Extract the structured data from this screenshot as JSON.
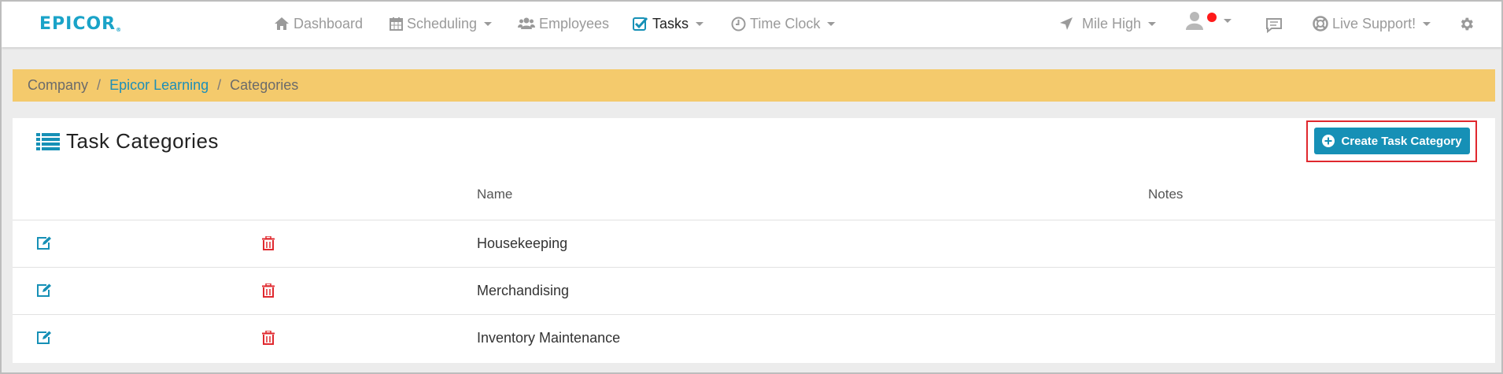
{
  "brand": {
    "logo_text": "EPICOR",
    "logo_mark": "®",
    "color": "#1aa3c8"
  },
  "nav": {
    "items": [
      {
        "label": "Dashboard",
        "icon": "home-icon"
      },
      {
        "label": "Scheduling",
        "icon": "calendar-icon"
      },
      {
        "label": "Employees",
        "icon": "users-icon"
      },
      {
        "label": "Tasks",
        "icon": "checkbox-icon"
      },
      {
        "label": "Time Clock",
        "icon": "clock-icon"
      }
    ],
    "location": "Mile High",
    "support": "Live Support!"
  },
  "breadcrumb": {
    "root": "Company",
    "link": "Epicor Learning",
    "current": "Categories",
    "separator": "/"
  },
  "panel": {
    "title": "Task Categories",
    "create_label": "Create Task Category",
    "columns": {
      "name": "Name",
      "notes": "Notes"
    },
    "rows": [
      {
        "name": "Housekeeping",
        "notes": ""
      },
      {
        "name": "Merchandising",
        "notes": ""
      },
      {
        "name": "Inventory Maintenance",
        "notes": ""
      }
    ]
  },
  "colors": {
    "accent": "#1690b6",
    "breadcrumb_bg": "#f4ca6c",
    "delete": "#e0282e",
    "notification_dot": "#ff1a1a"
  }
}
